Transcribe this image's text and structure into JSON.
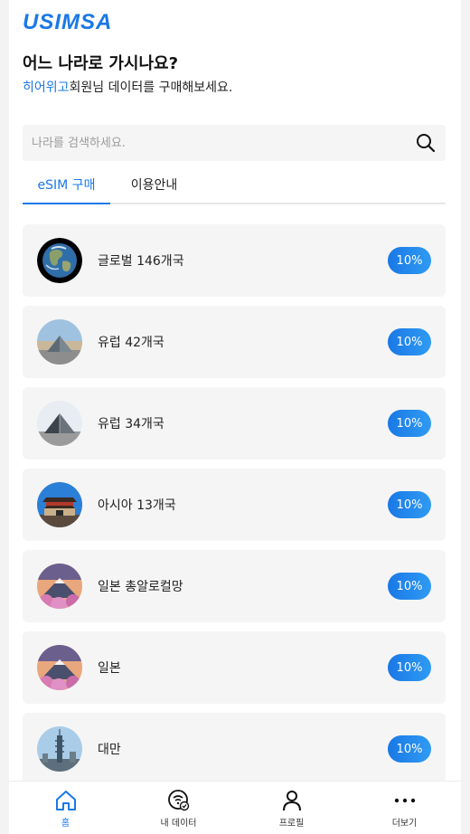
{
  "brand": {
    "logo_text": "USIMSA",
    "accent": "#1a78e6"
  },
  "header": {
    "title": "어느 나라로 가시나요?",
    "subtitle_highlight": "히어위고",
    "subtitle_rest": "회원님 데이터를 구매해보세요."
  },
  "search": {
    "placeholder": "나라를 검색하세요.",
    "value": "",
    "icon": "search-icon"
  },
  "tabs": [
    {
      "label": "eSIM 구매",
      "active": true
    },
    {
      "label": "이용안내",
      "active": false
    }
  ],
  "products": [
    {
      "label": "글로벌 146개국",
      "discount": "10%",
      "image": "earth-globe"
    },
    {
      "label": "유럽 42개국",
      "discount": "10%",
      "image": "louvre-pyramid"
    },
    {
      "label": "유럽 34개국",
      "discount": "10%",
      "image": "louvre-pyramid"
    },
    {
      "label": "아시아 13개국",
      "discount": "10%",
      "image": "asian-gate"
    },
    {
      "label": "일본 총알로컬망",
      "discount": "10%",
      "image": "mount-fuji"
    },
    {
      "label": "일본",
      "discount": "10%",
      "image": "mount-fuji"
    },
    {
      "label": "대만",
      "discount": "10%",
      "image": "taipei-101"
    }
  ],
  "bottom_nav": [
    {
      "label": "홈",
      "icon": "home-icon",
      "active": true
    },
    {
      "label": "내 데이터",
      "icon": "data-icon",
      "active": false
    },
    {
      "label": "프로필",
      "icon": "profile-icon",
      "active": false
    },
    {
      "label": "더보기",
      "icon": "more-icon",
      "active": false
    }
  ]
}
